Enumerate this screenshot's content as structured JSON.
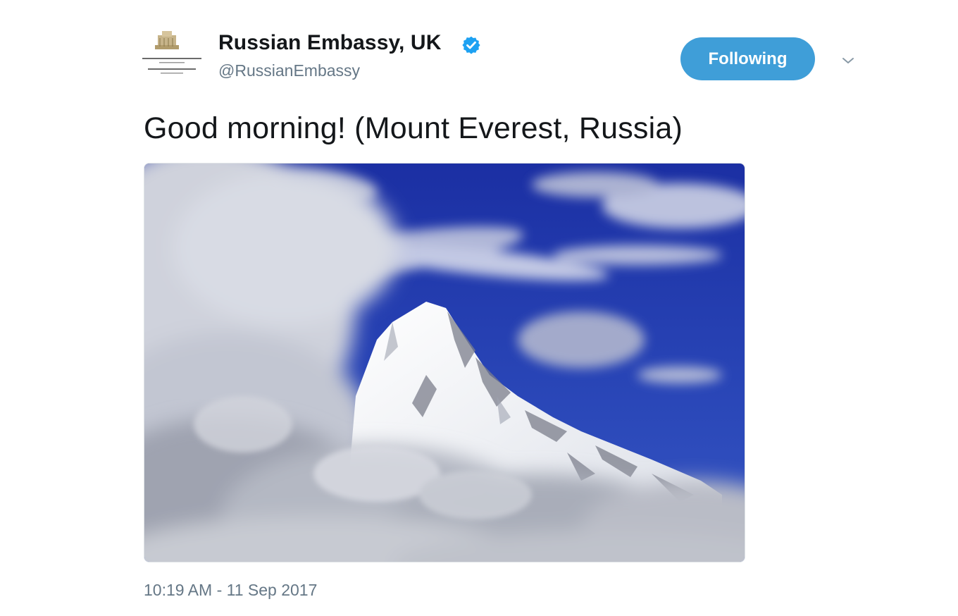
{
  "tweet": {
    "display_name": "Russian Embassy, UK",
    "handle": "@RussianEmbassy",
    "verified_icon": "verified-badge-icon",
    "follow_button_label": "Following",
    "caret_icon": "chevron-down-icon",
    "text": "Good morning! (Mount Everest, Russia)",
    "timestamp": "10:19 AM - 11 Sep 2017",
    "media_description_icon": "photo"
  },
  "colors": {
    "accent": "#1da1f2",
    "follow_button": "#3f9ed8",
    "secondary_text": "#657786",
    "sky": "#1c2f9e"
  }
}
